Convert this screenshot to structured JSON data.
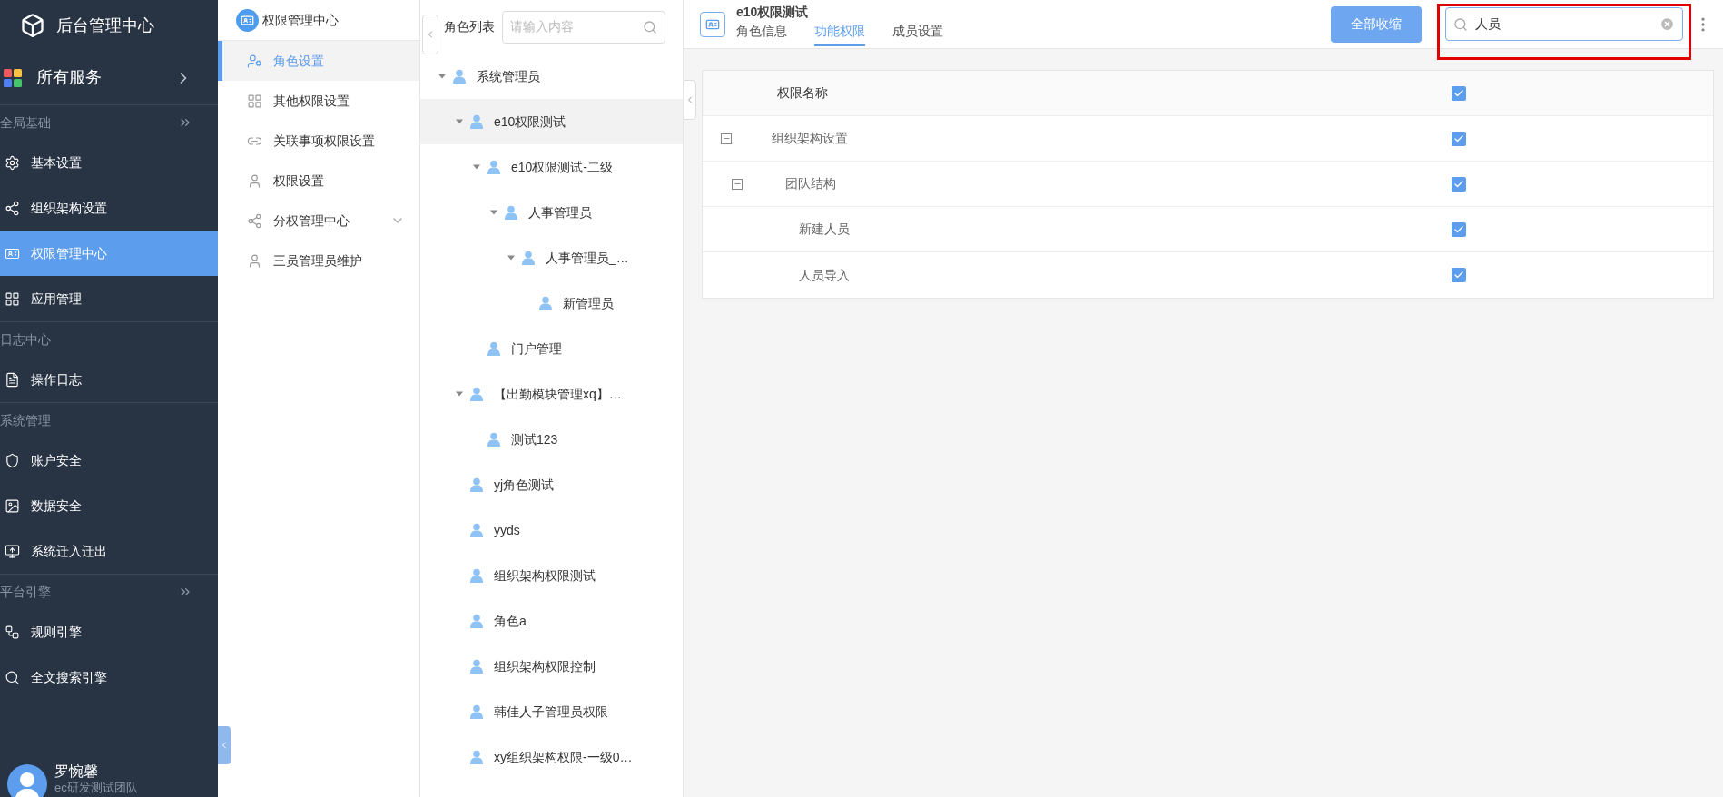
{
  "app": {
    "title": "后台管理中心"
  },
  "sidebar": {
    "services": {
      "label": "所有服务"
    },
    "sections": [
      {
        "title": "全局基础",
        "more": true,
        "items": [
          {
            "label": "基本设置",
            "selected": false
          },
          {
            "label": "组织架构设置",
            "selected": false
          },
          {
            "label": "权限管理中心",
            "selected": true
          },
          {
            "label": "应用管理",
            "selected": false
          }
        ]
      },
      {
        "title": "日志中心",
        "more": false,
        "items": [
          {
            "label": "操作日志",
            "selected": false
          }
        ]
      },
      {
        "title": "系统管理",
        "more": false,
        "items": [
          {
            "label": "账户安全",
            "selected": false
          },
          {
            "label": "数据安全",
            "selected": false
          },
          {
            "label": "系统迁入迁出",
            "selected": false
          }
        ]
      },
      {
        "title": "平台引擎",
        "more": true,
        "items": [
          {
            "label": "规则引擎",
            "selected": false
          },
          {
            "label": "全文搜索引擎",
            "selected": false
          }
        ]
      }
    ],
    "user": {
      "name": "罗惋馨",
      "team": "ec研发测试团队"
    }
  },
  "submenu": {
    "title": "权限管理中心",
    "items": [
      {
        "label": "角色设置",
        "selected": true
      },
      {
        "label": "其他权限设置",
        "selected": false
      },
      {
        "label": "关联事项权限设置",
        "selected": false
      },
      {
        "label": "权限设置",
        "selected": false
      },
      {
        "label": "分权管理中心",
        "selected": false,
        "expanded": false
      },
      {
        "label": "三员管理员维护",
        "selected": false
      }
    ]
  },
  "role_list": {
    "label": "角色列表",
    "search": {
      "placeholder": "请输入内容"
    },
    "tree": [
      {
        "label": "系统管理员",
        "selected": false,
        "expanded": true,
        "children": [
          {
            "label": "e10权限测试",
            "selected": true,
            "expanded": true,
            "children": [
              {
                "label": "e10权限测试-二级",
                "selected": false,
                "expanded": true,
                "children": [
                  {
                    "label": "人事管理员",
                    "selected": false,
                    "expanded": true,
                    "children": [
                      {
                        "label": "人事管理员_…",
                        "selected": false,
                        "expanded": true,
                        "children": [
                          {
                            "label": "新管理员",
                            "selected": false
                          }
                        ]
                      }
                    ]
                  }
                ]
              },
              {
                "label": "门户管理",
                "selected": false
              }
            ]
          },
          {
            "label": "【出勤模块管理xq】…",
            "selected": false,
            "expanded": true,
            "children": [
              {
                "label": "测试123",
                "selected": false
              }
            ]
          },
          {
            "label": "yj角色测试",
            "selected": false
          },
          {
            "label": "yyds",
            "selected": false
          },
          {
            "label": "组织架构权限测试",
            "selected": false
          },
          {
            "label": "角色a",
            "selected": false
          },
          {
            "label": "组织架构权限控制",
            "selected": false
          },
          {
            "label": "韩佳人子管理员权限",
            "selected": false
          },
          {
            "label": "xy组织架构权限-一级0…",
            "selected": false
          }
        ]
      }
    ]
  },
  "detail": {
    "title": "e10权限测试",
    "tabs": [
      {
        "label": "角色信息",
        "selected": false
      },
      {
        "label": "功能权限",
        "selected": true
      },
      {
        "label": "成员设置",
        "selected": false
      }
    ],
    "collapse_button": "全部收缩",
    "search": {
      "value": "人员",
      "highlighted": true
    },
    "table": {
      "header": {
        "label": "权限名称",
        "checked": true
      },
      "rows": [
        {
          "label": "组织架构设置",
          "checked": true,
          "expanded": true,
          "children": [
            {
              "label": "团队结构",
              "checked": true,
              "expanded": true,
              "children": [
                {
                  "label": "新建人员",
                  "checked": true
                },
                {
                  "label": "人员导入",
                  "checked": true
                }
              ]
            }
          ]
        }
      ]
    }
  }
}
